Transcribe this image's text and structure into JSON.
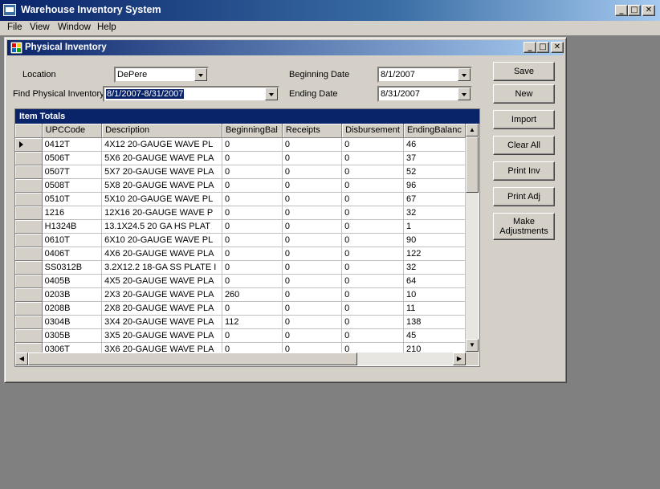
{
  "app": {
    "title": "Warehouse Inventory System"
  },
  "menu": [
    "File",
    "View",
    "Window",
    "Help"
  ],
  "child": {
    "title": "Physical Inventory"
  },
  "form": {
    "location_label": "Location",
    "location_value": "DePere",
    "find_label": "Find Physical Inventory",
    "find_value": "8/1/2007-8/31/2007",
    "begin_label": "Beginning Date",
    "begin_value": "8/1/2007",
    "end_label": "Ending Date",
    "end_value": "8/31/2007"
  },
  "buttons": {
    "save": "Save",
    "new": "New",
    "import": "Import",
    "clear_all": "Clear All",
    "print_inv": "Print Inv",
    "print_adj": "Print Adj",
    "make_adj_1": "Make",
    "make_adj_2": "Adjustments"
  },
  "grid": {
    "caption": "Item Totals",
    "columns": [
      "UPCCode",
      "Description",
      "BeginningBal",
      "Receipts",
      "Disbursement",
      "EndingBalanc"
    ],
    "rows": [
      [
        "0412T",
        "4X12 20-GAUGE WAVE PL",
        "0",
        "0",
        "0",
        "46"
      ],
      [
        "0506T",
        "5X6 20-GAUGE WAVE PLA",
        "0",
        "0",
        "0",
        "37"
      ],
      [
        "0507T",
        "5X7 20-GAUGE WAVE PLA",
        "0",
        "0",
        "0",
        "52"
      ],
      [
        "0508T",
        "5X8 20-GAUGE WAVE PLA",
        "0",
        "0",
        "0",
        "96"
      ],
      [
        "0510T",
        "5X10 20-GAUGE WAVE PL",
        "0",
        "0",
        "0",
        "67"
      ],
      [
        "1216",
        "12X16 20-GAUGE WAVE P",
        "0",
        "0",
        "0",
        "32"
      ],
      [
        "H1324B",
        "13.1X24.5  20 GA HS PLAT",
        "0",
        "0",
        "0",
        "1"
      ],
      [
        "0610T",
        "6X10 20-GAUGE WAVE PL",
        "0",
        "0",
        "0",
        "90"
      ],
      [
        "0406T",
        "4X6 20-GAUGE WAVE PLA",
        "0",
        "0",
        "0",
        "122"
      ],
      [
        "SS0312B",
        "3.2X12.2 18-GA SS PLATE I",
        "0",
        "0",
        "0",
        "32"
      ],
      [
        "0405B",
        "4X5 20-GAUGE WAVE PLA",
        "0",
        "0",
        "0",
        "64"
      ],
      [
        "0203B",
        "2X3 20-GAUGE WAVE PLA",
        "260",
        "0",
        "0",
        "10"
      ],
      [
        "0208B",
        "2X8 20-GAUGE WAVE PLA",
        "0",
        "0",
        "0",
        "11"
      ],
      [
        "0304B",
        "3X4 20-GAUGE WAVE PLA",
        "112",
        "0",
        "0",
        "138"
      ],
      [
        "0305B",
        "3X5 20-GAUGE WAVE PLA",
        "0",
        "0",
        "0",
        "45"
      ],
      [
        "0306T",
        "3X6 20-GAUGE WAVE PLA",
        "0",
        "0",
        "0",
        "210"
      ]
    ]
  }
}
